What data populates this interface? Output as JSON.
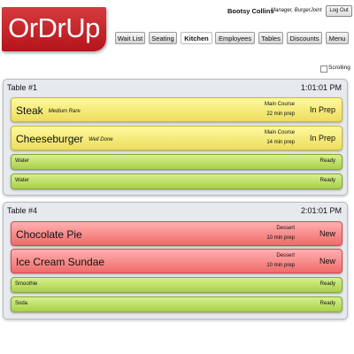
{
  "app": {
    "logo": "OrDrUp"
  },
  "user": {
    "name": "Bootsy Collins",
    "role": "Manager, BurgerJoint",
    "logout": "Log Out"
  },
  "nav": {
    "items": [
      "Wait List",
      "Seating",
      "Kitchen",
      "Employees",
      "Tables",
      "Discounts",
      "Menu"
    ],
    "active": "Kitchen"
  },
  "scrolling_label": "Scrolling",
  "tables": [
    {
      "title": "Table #1",
      "time": "1:01:01 PM",
      "items": [
        {
          "name": "Steak",
          "note": "Medium Rare",
          "category": "Main Course",
          "prep": "22 min prep",
          "status": "In Prep"
        },
        {
          "name": "Cheeseburger",
          "note": "Well Done",
          "category": "Main Course",
          "prep": "14 min prep",
          "status": "In Prep"
        },
        {
          "name": "Water",
          "status": "Ready"
        },
        {
          "name": "Water",
          "status": "Ready"
        }
      ]
    },
    {
      "title": "Table #4",
      "time": "2:01:01 PM",
      "items": [
        {
          "name": "Chocolate Pie",
          "note": "",
          "category": "Dessert",
          "prep": "10 min prep",
          "status": "New"
        },
        {
          "name": "Ice Cream Sundae",
          "note": "",
          "category": "Dessert",
          "prep": "10 min prep",
          "status": "New"
        },
        {
          "name": "Smoothie",
          "status": "Ready"
        },
        {
          "name": "Soda",
          "status": "Ready"
        }
      ]
    }
  ],
  "colors": {
    "in_prep": "#f5ec7a",
    "new": "#f58a8a",
    "ready": "#bde066",
    "logo": "#c4222a"
  }
}
